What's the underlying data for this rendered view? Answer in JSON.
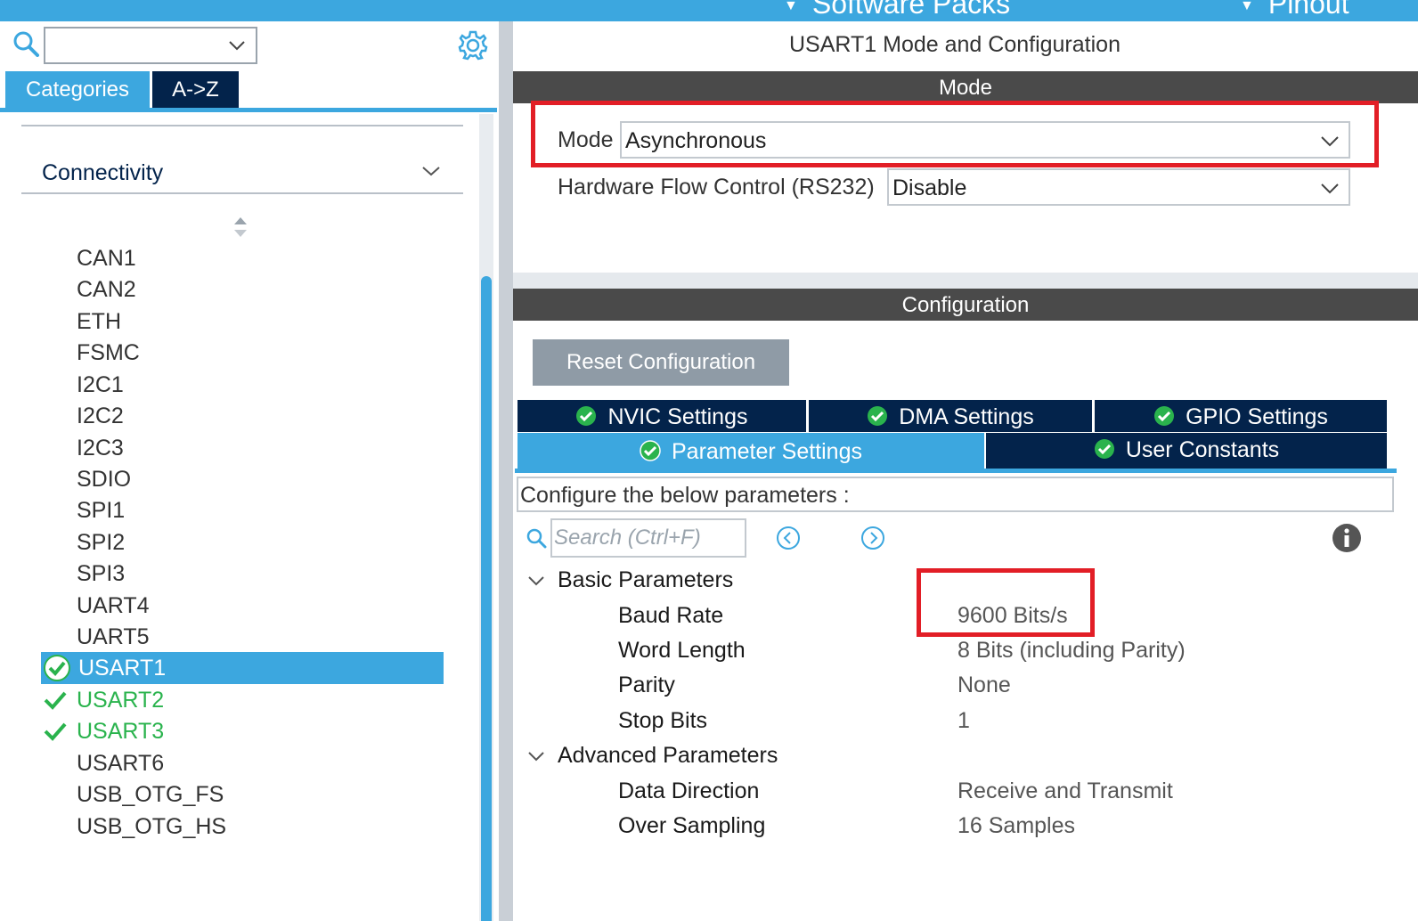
{
  "topbar": {
    "menu_software_packs": "Software Packs",
    "menu_pinout": "Pinout"
  },
  "sidebar": {
    "search_value": "",
    "tabs": [
      {
        "label": "Categories",
        "active": true
      },
      {
        "label": "A->Z",
        "active": false
      }
    ],
    "category": "Connectivity",
    "items": [
      {
        "label": "CAN1",
        "state": "none"
      },
      {
        "label": "CAN2",
        "state": "none"
      },
      {
        "label": "ETH",
        "state": "none"
      },
      {
        "label": "FSMC",
        "state": "none"
      },
      {
        "label": "I2C1",
        "state": "none"
      },
      {
        "label": "I2C2",
        "state": "none"
      },
      {
        "label": "I2C3",
        "state": "none"
      },
      {
        "label": "SDIO",
        "state": "none"
      },
      {
        "label": "SPI1",
        "state": "none"
      },
      {
        "label": "SPI2",
        "state": "none"
      },
      {
        "label": "SPI3",
        "state": "none"
      },
      {
        "label": "UART4",
        "state": "none"
      },
      {
        "label": "UART5",
        "state": "none"
      },
      {
        "label": "USART1",
        "state": "selected"
      },
      {
        "label": "USART2",
        "state": "configured"
      },
      {
        "label": "USART3",
        "state": "configured"
      },
      {
        "label": "USART6",
        "state": "none"
      },
      {
        "label": "USB_OTG_FS",
        "state": "none"
      },
      {
        "label": "USB_OTG_HS",
        "state": "none"
      }
    ]
  },
  "main": {
    "title": "USART1 Mode and Configuration",
    "mode_section": {
      "header": "Mode",
      "mode_label": "Mode",
      "mode_value": "Asynchronous",
      "flow_label": "Hardware Flow Control (RS232)",
      "flow_value": "Disable"
    },
    "config_section": {
      "header": "Configuration",
      "reset_button": "Reset Configuration",
      "tabs_row1": [
        "NVIC Settings",
        "DMA Settings",
        "GPIO Settings"
      ],
      "tabs_row2": [
        "Parameter Settings",
        "User Constants"
      ],
      "active_tab": "Parameter Settings",
      "configure_text": "Configure the below parameters :",
      "search_placeholder": "Search (Ctrl+F)",
      "groups": [
        {
          "name": "Basic Parameters",
          "params": [
            {
              "name": "Baud Rate",
              "value": "9600 Bits/s"
            },
            {
              "name": "Word Length",
              "value": "8 Bits (including Parity)"
            },
            {
              "name": "Parity",
              "value": "None"
            },
            {
              "name": "Stop Bits",
              "value": "1"
            }
          ]
        },
        {
          "name": "Advanced Parameters",
          "params": [
            {
              "name": "Data Direction",
              "value": "Receive and Transmit"
            },
            {
              "name": "Over Sampling",
              "value": "16 Samples"
            }
          ]
        }
      ]
    }
  },
  "colors": {
    "accent_blue": "#3ca7df",
    "navy": "#03234b",
    "highlight_red": "#e21e26",
    "configured_green": "#2ab34d"
  }
}
